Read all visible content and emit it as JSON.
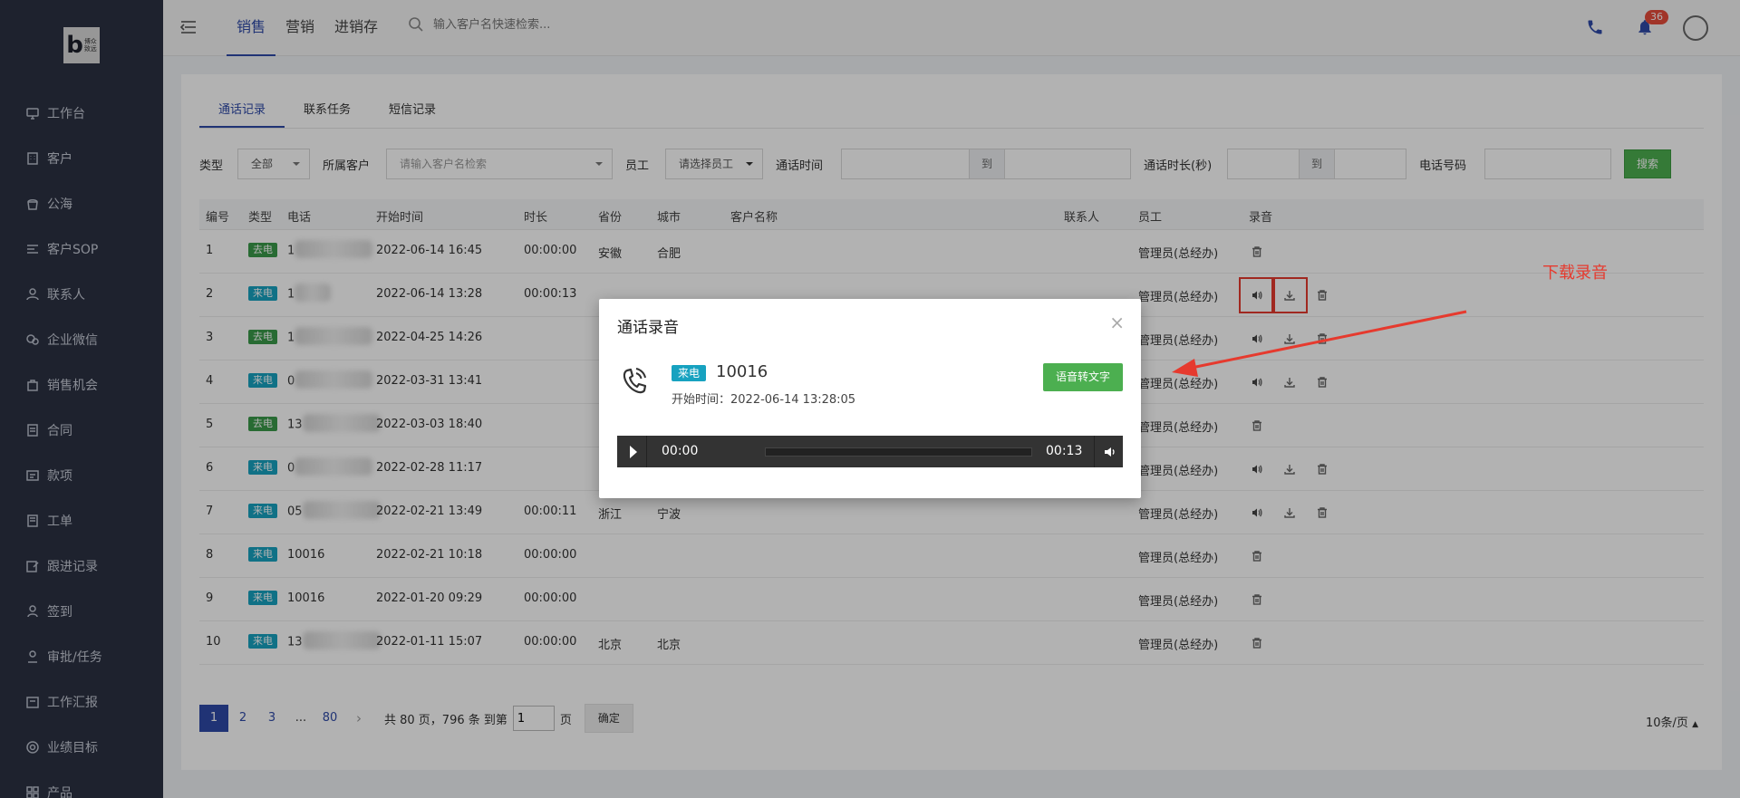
{
  "sidebar": {
    "logo_text": "博众\n致远",
    "items": [
      {
        "label": "工作台",
        "icon": "monitor-icon"
      },
      {
        "label": "客户",
        "icon": "building-icon"
      },
      {
        "label": "公海",
        "icon": "pool-icon"
      },
      {
        "label": "客户SOP",
        "icon": "sop-icon"
      },
      {
        "label": "联系人",
        "icon": "contact-icon"
      },
      {
        "label": "企业微信",
        "icon": "wechat-icon"
      },
      {
        "label": "销售机会",
        "icon": "bag-icon"
      },
      {
        "label": "合同",
        "icon": "contract-icon"
      },
      {
        "label": "款项",
        "icon": "payment-icon"
      },
      {
        "label": "工单",
        "icon": "ticket-icon"
      },
      {
        "label": "跟进记录",
        "icon": "edit-icon"
      },
      {
        "label": "签到",
        "icon": "checkin-icon"
      },
      {
        "label": "审批/任务",
        "icon": "approval-icon"
      },
      {
        "label": "工作汇报",
        "icon": "report-icon"
      },
      {
        "label": "业绩目标",
        "icon": "target-icon"
      },
      {
        "label": "产品",
        "icon": "grid-icon"
      }
    ]
  },
  "topbar": {
    "tabs": [
      "销售",
      "营销",
      "进销存"
    ],
    "active_tab": 0,
    "search_placeholder": "输入客户名快速检索...",
    "notification_count": "36"
  },
  "subtabs": [
    "通话记录",
    "联系任务",
    "短信记录"
  ],
  "filters": {
    "type_label": "类型",
    "type_value": "全部",
    "customer_label": "所属客户",
    "customer_placeholder": "请输入客户名检索",
    "staff_label": "员工",
    "staff_value": "请选择员工",
    "call_time_label": "通话时间",
    "to_label": "到",
    "duration_label": "通话时长(秒)",
    "to_label2": "到",
    "phone_label": "电话号码",
    "search_button": "搜索"
  },
  "table": {
    "headers": [
      "编号",
      "类型",
      "电话",
      "开始时间",
      "时长",
      "省份",
      "城市",
      "客户名称",
      "联系人",
      "员工",
      "录音"
    ],
    "rows": [
      {
        "id": "1",
        "type": "去电",
        "phone": "1",
        "start": "2022-06-14 16:45",
        "duration": "00:00:00",
        "province": "安徽",
        "city": "合肥",
        "staff": "管理员(总经办)",
        "rec": "delete"
      },
      {
        "id": "2",
        "type": "来电",
        "phone": "1",
        "start": "2022-06-14 13:28",
        "duration": "00:00:13",
        "province": "",
        "city": "",
        "staff": "管理员(总经办)",
        "rec": "full"
      },
      {
        "id": "3",
        "type": "去电",
        "phone": "1",
        "start": "2022-04-25 14:26",
        "duration": "",
        "province": "",
        "city": "",
        "staff": "管理员(总经办)",
        "rec": "full"
      },
      {
        "id": "4",
        "type": "来电",
        "phone": "0",
        "start": "2022-03-31 13:41",
        "duration": "",
        "province": "",
        "city": "",
        "staff": "管理员(总经办)",
        "rec": "full"
      },
      {
        "id": "5",
        "type": "去电",
        "phone": "13",
        "start": "2022-03-03 18:40",
        "duration": "",
        "province": "",
        "city": "",
        "staff": "管理员(总经办)",
        "rec": "delete"
      },
      {
        "id": "6",
        "type": "来电",
        "phone": "0",
        "start": "2022-02-28 11:17",
        "duration": "",
        "province": "",
        "city": "",
        "staff": "管理员(总经办)",
        "rec": "full"
      },
      {
        "id": "7",
        "type": "来电",
        "phone": "05",
        "start": "2022-02-21 13:49",
        "duration": "00:00:11",
        "province": "浙江",
        "city": "宁波",
        "staff": "管理员(总经办)",
        "rec": "full"
      },
      {
        "id": "8",
        "type": "来电",
        "phone": "10016",
        "start": "2022-02-21 10:18",
        "duration": "00:00:00",
        "province": "",
        "city": "",
        "staff": "管理员(总经办)",
        "rec": "delete"
      },
      {
        "id": "9",
        "type": "来电",
        "phone": "10016",
        "start": "2022-01-20 09:29",
        "duration": "00:00:00",
        "province": "",
        "city": "",
        "staff": "管理员(总经办)",
        "rec": "delete"
      },
      {
        "id": "10",
        "type": "来电",
        "phone": "13",
        "start": "2022-01-11 15:07",
        "duration": "00:00:00",
        "province": "北京",
        "city": "北京",
        "staff": "管理员(总经办)",
        "rec": "delete"
      }
    ]
  },
  "pagination": {
    "pages": [
      "1",
      "2",
      "3",
      "...",
      "80"
    ],
    "active": "1",
    "info": "共 80 页，796 条 到第",
    "goto_value": "1",
    "page_unit": "页",
    "ok": "确定",
    "per_page": "10条/页"
  },
  "modal": {
    "title": "通话录音",
    "tag": "来电",
    "number": "10016",
    "start_time": "开始时间：2022-06-14 13:28:05",
    "stt_button": "语音转文字",
    "player_current": "00:00",
    "player_total": "00:13",
    "progress": 0
  },
  "annotation": {
    "label": "下载录音",
    "color": "#e63a2e"
  },
  "colors": {
    "sidebar_bg": "#2b3143",
    "primary": "#2f4aa8",
    "green": "#4caf50",
    "tag_out": "#3a9a4a",
    "tag_in": "#17a2c0"
  }
}
